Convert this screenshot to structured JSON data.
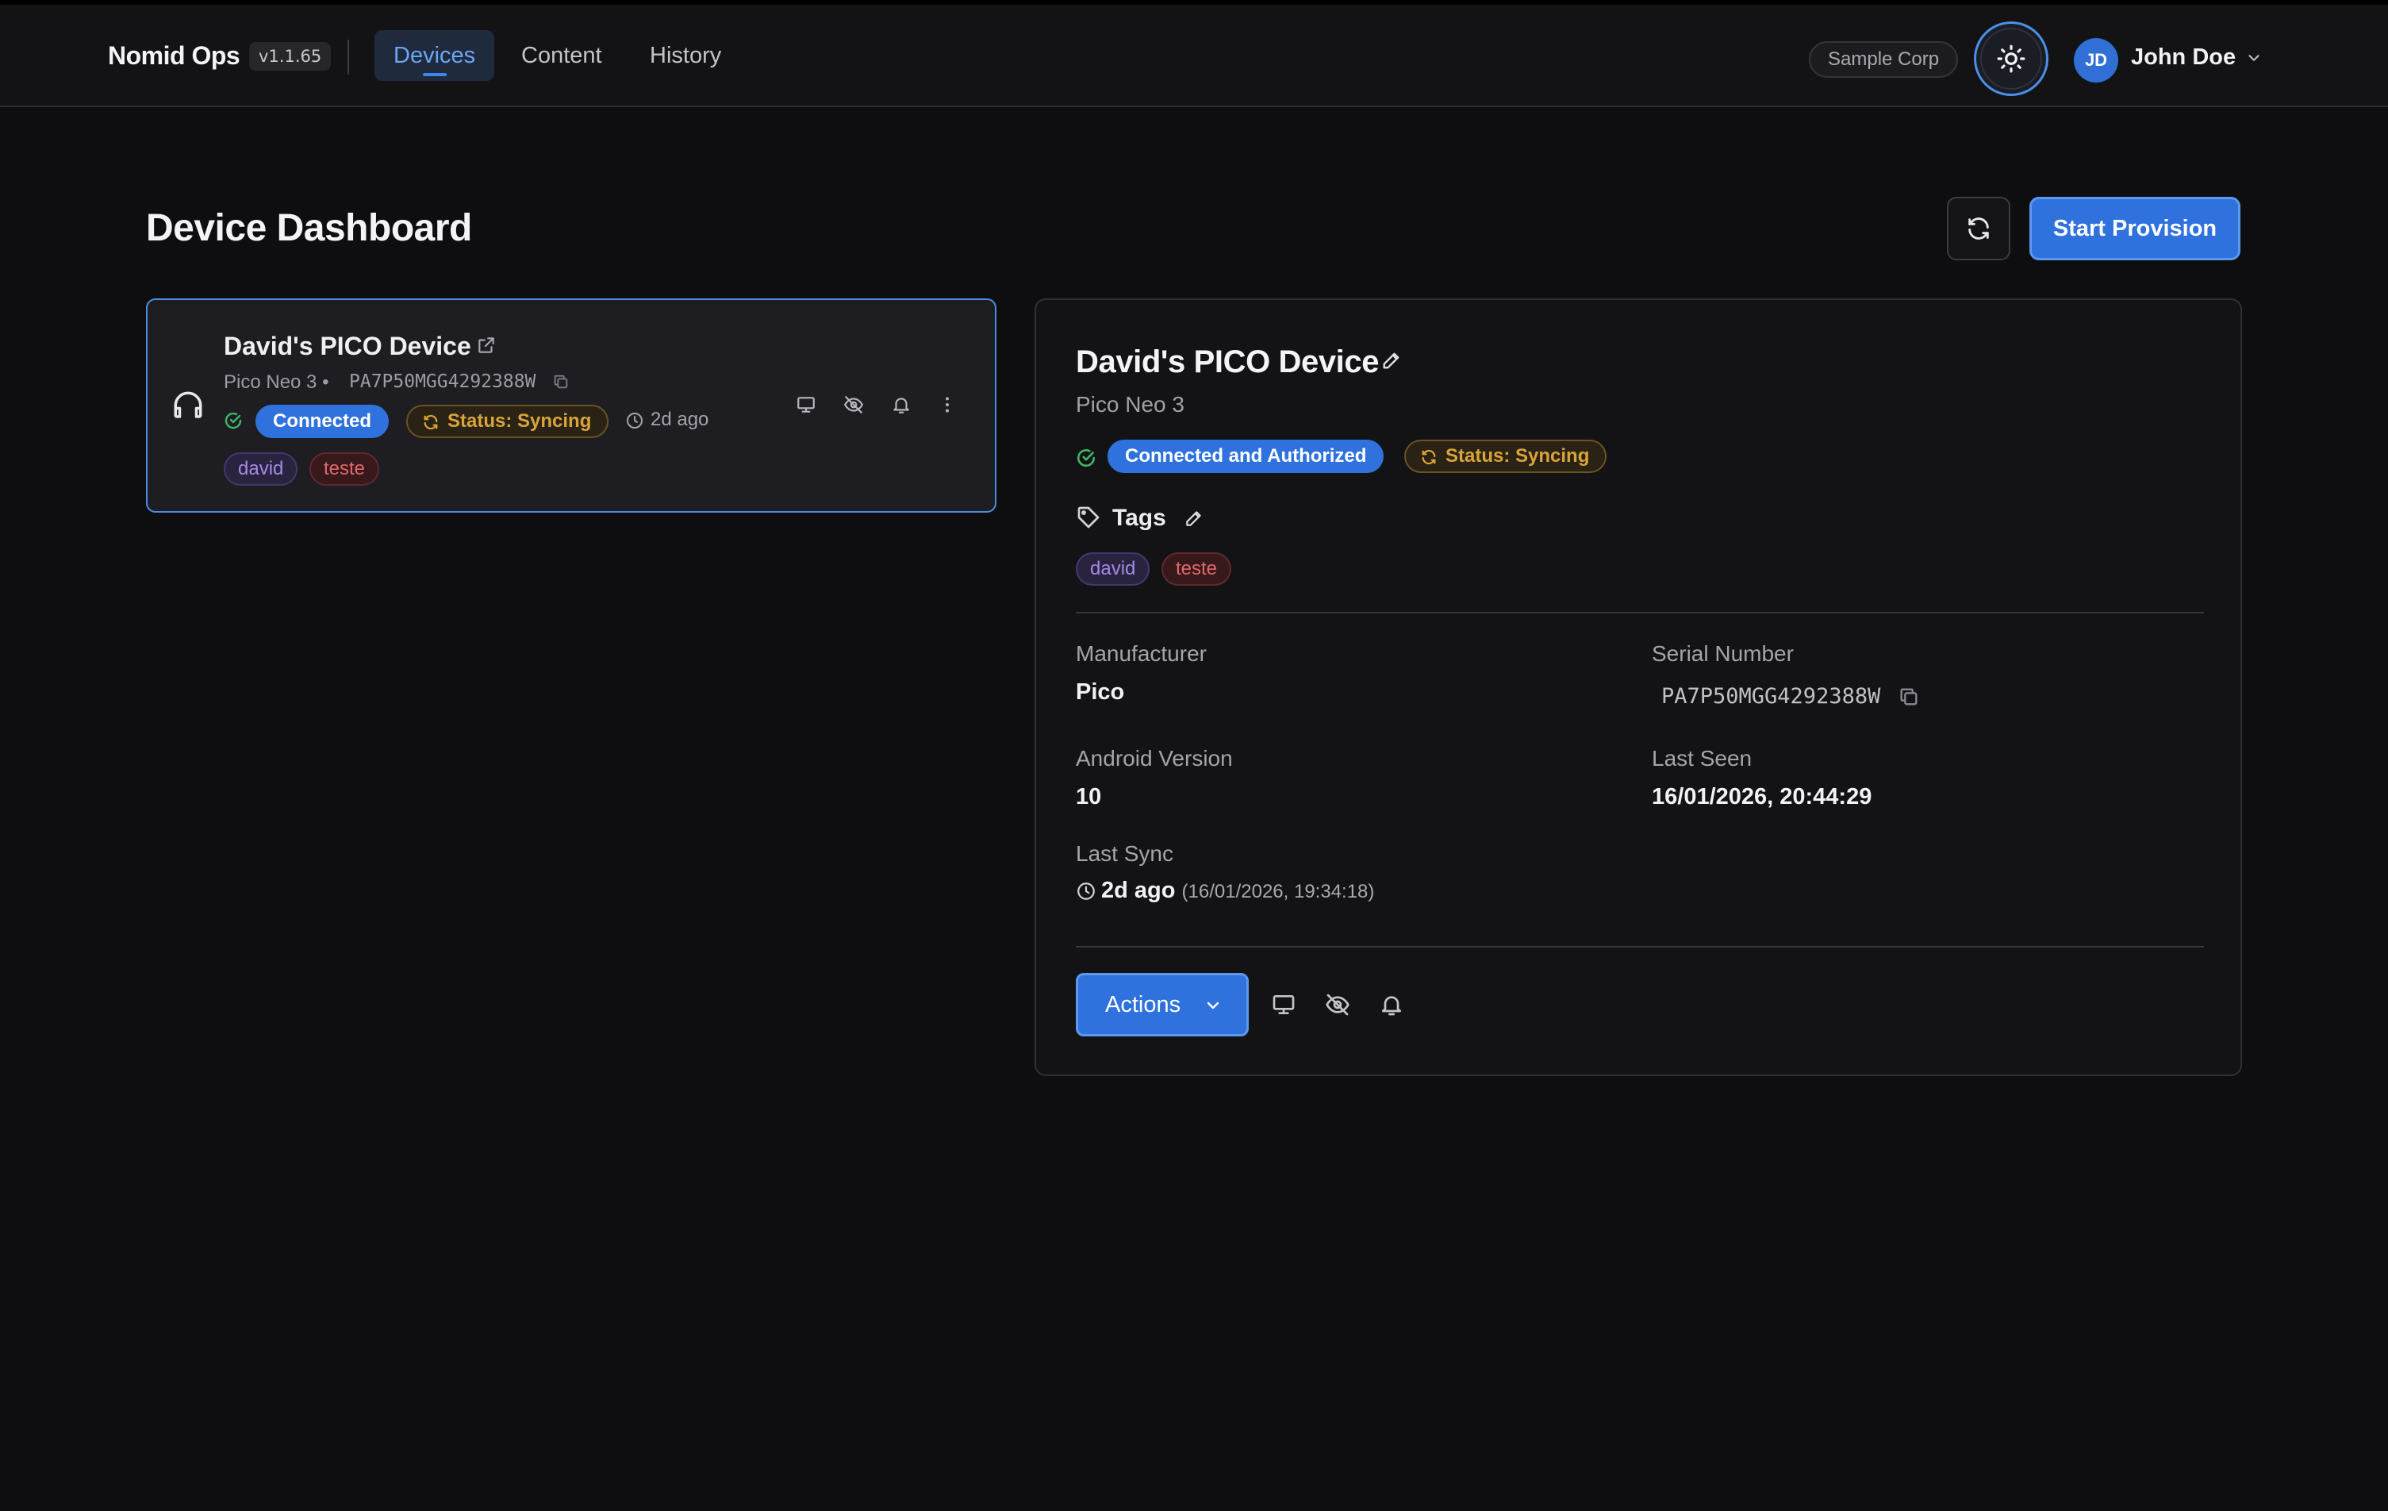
{
  "header": {
    "brand": "Nomid Ops",
    "version": "v1.1.65",
    "tabs": [
      "Devices",
      "Content",
      "History"
    ],
    "active_tab": "Devices",
    "organization": "Sample Corp",
    "user_initials": "JD",
    "user_name": "John Doe"
  },
  "page": {
    "title": "Device Dashboard",
    "start_provision_label": "Start Provision"
  },
  "device_card": {
    "name": "David's PICO Device",
    "model": "Pico Neo 3 •",
    "serial": "PA7P50MGG4292388W",
    "connection_status": "Connected",
    "sync_status": "Status: Syncing",
    "last_seen_ago": "2d ago",
    "tags": [
      "david",
      "teste"
    ]
  },
  "detail": {
    "name": "David's PICO Device",
    "model": "Pico Neo 3",
    "connection_status": "Connected and Authorized",
    "sync_status": "Status: Syncing",
    "tags_label": "Tags",
    "tags": [
      "david",
      "teste"
    ],
    "manufacturer_label": "Manufacturer",
    "manufacturer": "Pico",
    "serial_label": "Serial Number",
    "serial": "PA7P50MGG4292388W",
    "android_label": "Android Version",
    "android_version": "10",
    "last_seen_label": "Last Seen",
    "last_seen": "16/01/2026, 20:44:29",
    "last_sync_label": "Last Sync",
    "last_sync_ago": "2d ago",
    "last_sync_full": "(16/01/2026, 19:34:18)",
    "actions_label": "Actions"
  },
  "colors": {
    "accent": "#2f72dd",
    "syncing": "#d9a43a",
    "success": "#3fb76a",
    "tag_purple": "#a48ae6",
    "tag_red": "#e0686c"
  }
}
